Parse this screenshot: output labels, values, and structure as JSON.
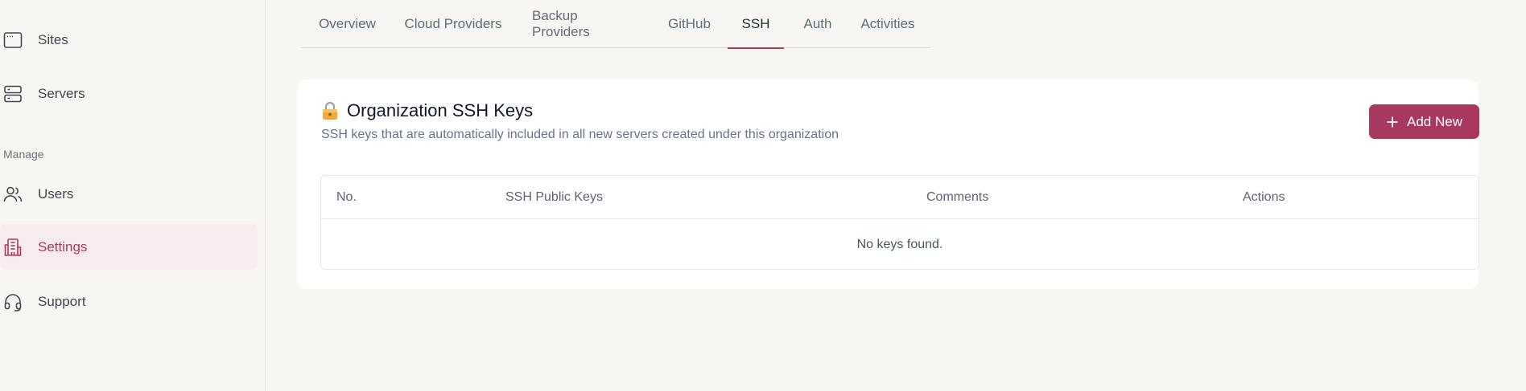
{
  "sidebar": {
    "items": [
      {
        "label": "Sites",
        "icon": "browser-window-icon"
      },
      {
        "label": "Servers",
        "icon": "server-icon"
      },
      {
        "label": "Users",
        "icon": "users-icon"
      },
      {
        "label": "Settings",
        "icon": "building-settings-icon",
        "active": true
      },
      {
        "label": "Support",
        "icon": "headset-icon"
      }
    ],
    "section_manage": "Manage"
  },
  "tabs": [
    {
      "label": "Overview"
    },
    {
      "label": "Cloud Providers"
    },
    {
      "label": "Backup Providers"
    },
    {
      "label": "GitHub"
    },
    {
      "label": "SSH",
      "active": true
    },
    {
      "label": "Auth"
    },
    {
      "label": "Activities"
    }
  ],
  "card": {
    "title": "Organization SSH Keys",
    "title_icon": "lock-icon",
    "subtitle": "SSH keys that are automatically included in all new servers created under this organization",
    "add_button": "Add New"
  },
  "table": {
    "columns": [
      "No.",
      "SSH Public Keys",
      "Comments",
      "Actions"
    ],
    "empty_message": "No keys found."
  },
  "colors": {
    "accent": "#a8385f",
    "background": "#f8f6f2",
    "card": "#ffffff"
  }
}
